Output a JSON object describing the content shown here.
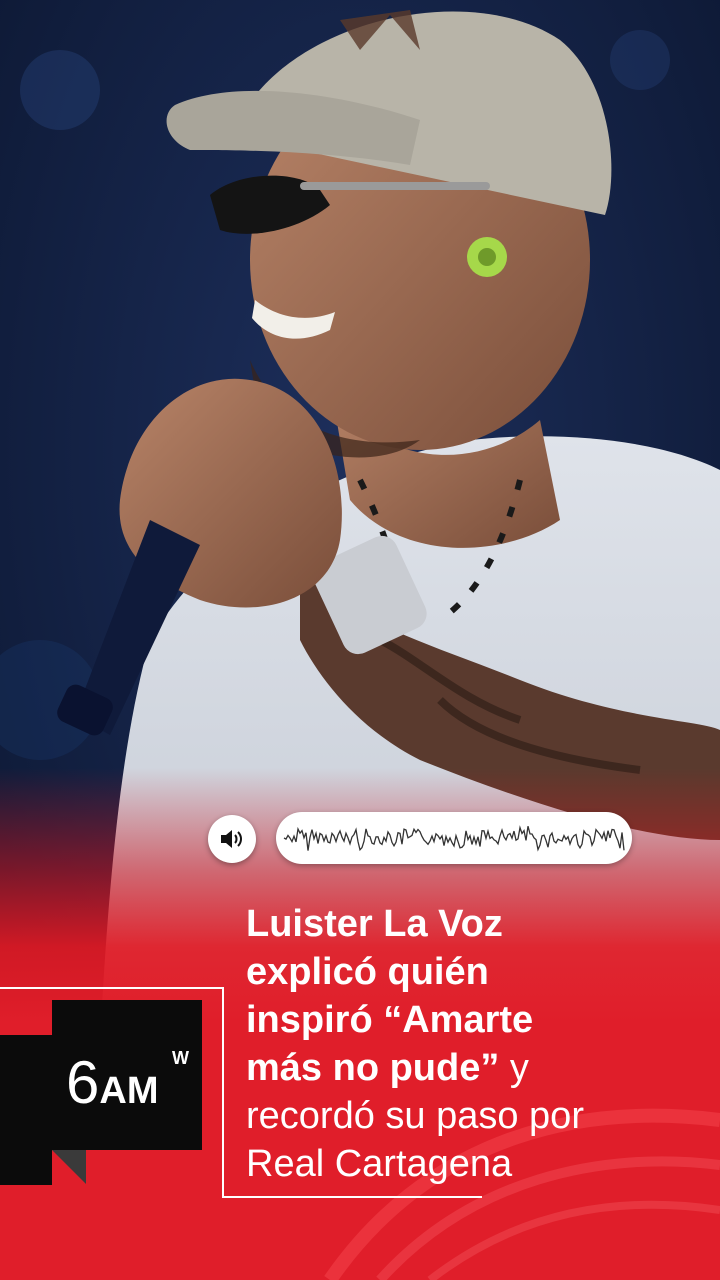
{
  "headline": {
    "line1": "Luister La Voz",
    "line2": "explicó quién",
    "line3": "inspiró “Amarte",
    "line4_bold": "más no pude”",
    "line4_regular": " y",
    "line5": "recordó su paso por",
    "line6": "Real Cartagena"
  },
  "logo": {
    "number": "6",
    "letters": "AM",
    "superscript": "W"
  },
  "audio": {
    "icon": "speaker-icon"
  },
  "colors": {
    "brand_red": "#e01e2a",
    "logo_black": "#0b0b0b",
    "night_blue": "#0d1a38"
  }
}
